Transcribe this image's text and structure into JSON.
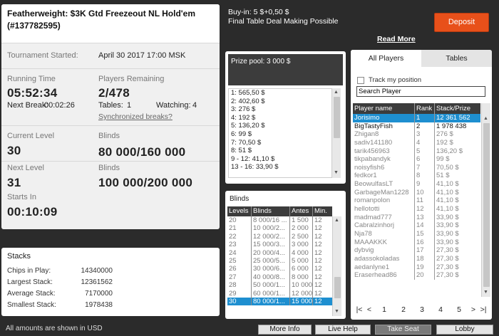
{
  "tournament": {
    "title_line1": "Featherweight: $3K Gtd Freezeout NL Hold'em",
    "title_line2": "(#137782595)",
    "started_label": "Tournament Started:",
    "started_value": "April 30 2017  17:00 MSK",
    "running_label": "Running Time",
    "running_value": "05:52:34",
    "next_break_label": "Next Break:",
    "next_break_value": "00:02:26",
    "players_label": "Players Remaining",
    "players_value": "2/478",
    "tables_label": "Tables:",
    "tables_value": "1",
    "watching_label": "Watching:",
    "watching_value": "4",
    "sync_breaks": "Synchronized breaks?",
    "current_level_label": "Current Level",
    "current_level_value": "30",
    "blinds_label": "Blinds",
    "current_blinds_value": "80 000/160 000",
    "next_level_label": "Next Level",
    "next_level_value": "31",
    "next_blinds_label": "Blinds",
    "next_blinds_value": "100 000/200 000",
    "starts_in_label": "Starts In",
    "starts_in_value": "00:10:09"
  },
  "stacks": {
    "title": "Stacks",
    "rows": [
      {
        "label": "Chips in Play:",
        "value": "14340000"
      },
      {
        "label": "Largest Stack:",
        "value": "12361562"
      },
      {
        "label": "Average Stack:",
        "value": "7170000"
      },
      {
        "label": "Smallest Stack:",
        "value": "1978438"
      }
    ]
  },
  "footer_note": "All amounts are shown in USD",
  "top": {
    "buyin": "Buy-in: 5 $+0,50 $",
    "deal": "Final Table Deal Making Possible",
    "read_more": "Read More",
    "deposit": "Deposit"
  },
  "prize": {
    "pool": "Prize pool: 3 000 $",
    "items": [
      "1: 565,50 $",
      "2: 402,60 $",
      "3: 276 $",
      "4: 192 $",
      "5: 136,20 $",
      "6: 99 $",
      "7: 70,50 $",
      "8: 51 $",
      "9 - 12: 41,10 $",
      "13 - 16: 33,90 $"
    ]
  },
  "blinds": {
    "title": "Blinds",
    "headers": [
      "Levels",
      "Blinds",
      "Antes",
      "Min."
    ],
    "rows": [
      [
        "20",
        "8 000/16 ...",
        "1 500",
        "12"
      ],
      [
        "21",
        "10 000/2...",
        "2 000",
        "12"
      ],
      [
        "22",
        "12 000/2...",
        "2 500",
        "12"
      ],
      [
        "23",
        "15 000/3...",
        "3 000",
        "12"
      ],
      [
        "24",
        "20 000/4...",
        "4 000",
        "12"
      ],
      [
        "25",
        "25 000/5...",
        "5 000",
        "12"
      ],
      [
        "26",
        "30 000/6...",
        "6 000",
        "12"
      ],
      [
        "27",
        "40 000/8...",
        "8 000",
        "12"
      ],
      [
        "28",
        "50 000/1...",
        "10 000",
        "12"
      ],
      [
        "29",
        "60 000/1...",
        "12 000",
        "12"
      ],
      [
        "30",
        "80 000/1...",
        "15 000",
        "12"
      ]
    ],
    "selected_index": 10
  },
  "players": {
    "tab_all": "All Players",
    "tab_tables": "Tables",
    "track_label": "Track my position",
    "search_value": "Search Player",
    "headers": [
      "Player name",
      "Rank",
      "Stack/Prize"
    ],
    "rows": [
      [
        "Jorisimo",
        "1",
        "12 361 562"
      ],
      [
        "BigTastyFish",
        "2",
        "1 978 438"
      ],
      [
        "Zhigan8",
        "3",
        "276 $"
      ],
      [
        "sadiv141180",
        "4",
        "192 $"
      ],
      [
        "tarik456963",
        "5",
        "136,20 $"
      ],
      [
        "tikpabandyk",
        "6",
        "99 $"
      ],
      [
        "noisyfish6",
        "7",
        "70,50 $"
      ],
      [
        "fedkor1",
        "8",
        "51 $"
      ],
      [
        "BeowulfasLT",
        "9",
        "41,10 $"
      ],
      [
        "GarbageMan1228",
        "10",
        "41,10 $"
      ],
      [
        "romanpolon",
        "11",
        "41,10 $"
      ],
      [
        "hellototti",
        "12",
        "41,10 $"
      ],
      [
        "madmad777",
        "13",
        "33,90 $"
      ],
      [
        "Cabralzinhorj",
        "14",
        "33,90 $"
      ],
      [
        "Nja78",
        "15",
        "33,90 $"
      ],
      [
        "MAAAKKK",
        "16",
        "33,90 $"
      ],
      [
        "dybvig",
        "17",
        "27,30 $"
      ],
      [
        "adassokoladas",
        "18",
        "27,30 $"
      ],
      [
        "aedanlyne1",
        "19",
        "27,30 $"
      ],
      [
        "Eraserhead86",
        "20",
        "27,30 $"
      ]
    ],
    "pages": [
      "1",
      "2",
      "3",
      "4",
      "5"
    ]
  },
  "buttons": {
    "more_info": "More Info",
    "live_help": "Live Help",
    "take_seat": "Take Seat",
    "lobby": "Lobby"
  }
}
